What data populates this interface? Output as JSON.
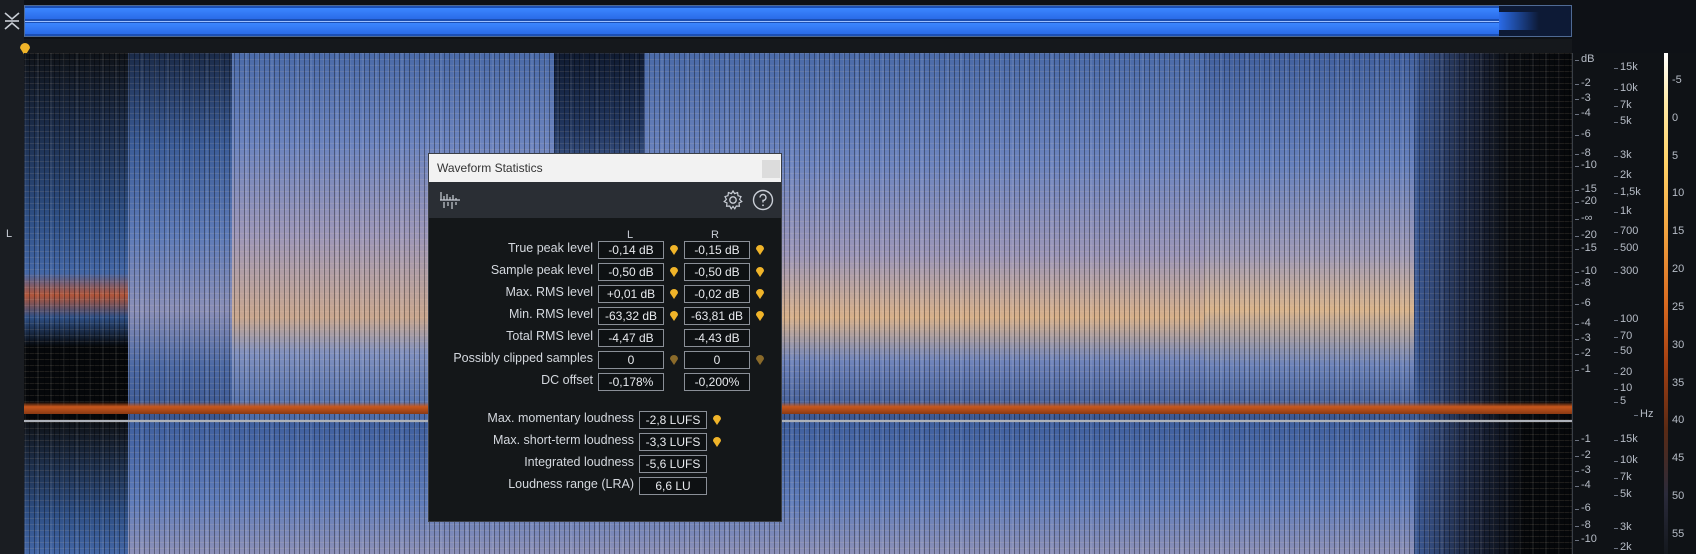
{
  "channels": {
    "left_label": "L"
  },
  "db_scale": {
    "unit": "dB",
    "top_ticks": [
      "-2",
      "-3",
      "-4",
      "-6",
      "-8",
      "-10",
      "-15",
      "-20",
      "-∞",
      "-20",
      "-15",
      "-10",
      "-8",
      "-6",
      "-4",
      "-3",
      "-2",
      "-1"
    ],
    "bottom_ticks": [
      "-1",
      "-2",
      "-3",
      "-4",
      "-6",
      "-8",
      "-10"
    ]
  },
  "hz_scale": {
    "unit": "Hz",
    "top_ticks": [
      "15k",
      "10k",
      "7k",
      "5k",
      "3k",
      "2k",
      "1,5k",
      "1k",
      "700",
      "500",
      "300",
      "100",
      "70",
      "50",
      "20",
      "10",
      "5"
    ],
    "bottom_ticks": [
      "15k",
      "10k",
      "7k",
      "5k",
      "3k",
      "2k"
    ]
  },
  "color_scale": {
    "ticks": [
      "-5",
      "0",
      "5",
      "10",
      "15",
      "20",
      "25",
      "30",
      "35",
      "40",
      "45",
      "50",
      "55"
    ]
  },
  "dialog": {
    "title": "Waveform Statistics",
    "col_left": "L",
    "col_right": "R",
    "rows": [
      {
        "label": "True peak level",
        "left": "-0,14 dB",
        "right": "-0,15 dB"
      },
      {
        "label": "Sample peak level",
        "left": "-0,50 dB",
        "right": "-0,50 dB"
      },
      {
        "label": "Max. RMS level",
        "left": "+0,01 dB",
        "right": "-0,02 dB"
      },
      {
        "label": "Min. RMS level",
        "left": "-63,32 dB",
        "right": "-63,81 dB"
      },
      {
        "label": "Total RMS level",
        "left": "-4,47 dB",
        "right": "-4,43 dB"
      },
      {
        "label": "Possibly clipped samples",
        "left": "0",
        "right": "0"
      },
      {
        "label": "DC offset",
        "left": "-0,178%",
        "right": "-0,200%"
      }
    ],
    "loudness": [
      {
        "label": "Max. momentary loudness",
        "value": "-2,8 LUFS"
      },
      {
        "label": "Max. short-term loudness",
        "value": "-3,3 LUFS"
      },
      {
        "label": "Integrated loudness",
        "value": "-5,6 LUFS"
      },
      {
        "label": "Loudness range (LRA)",
        "value": "6,6 LU"
      }
    ]
  },
  "colors": {
    "accent": "#f0b429",
    "spectrum_blue": "#4a6fb0",
    "spectrum_orange": "#c8571c"
  }
}
